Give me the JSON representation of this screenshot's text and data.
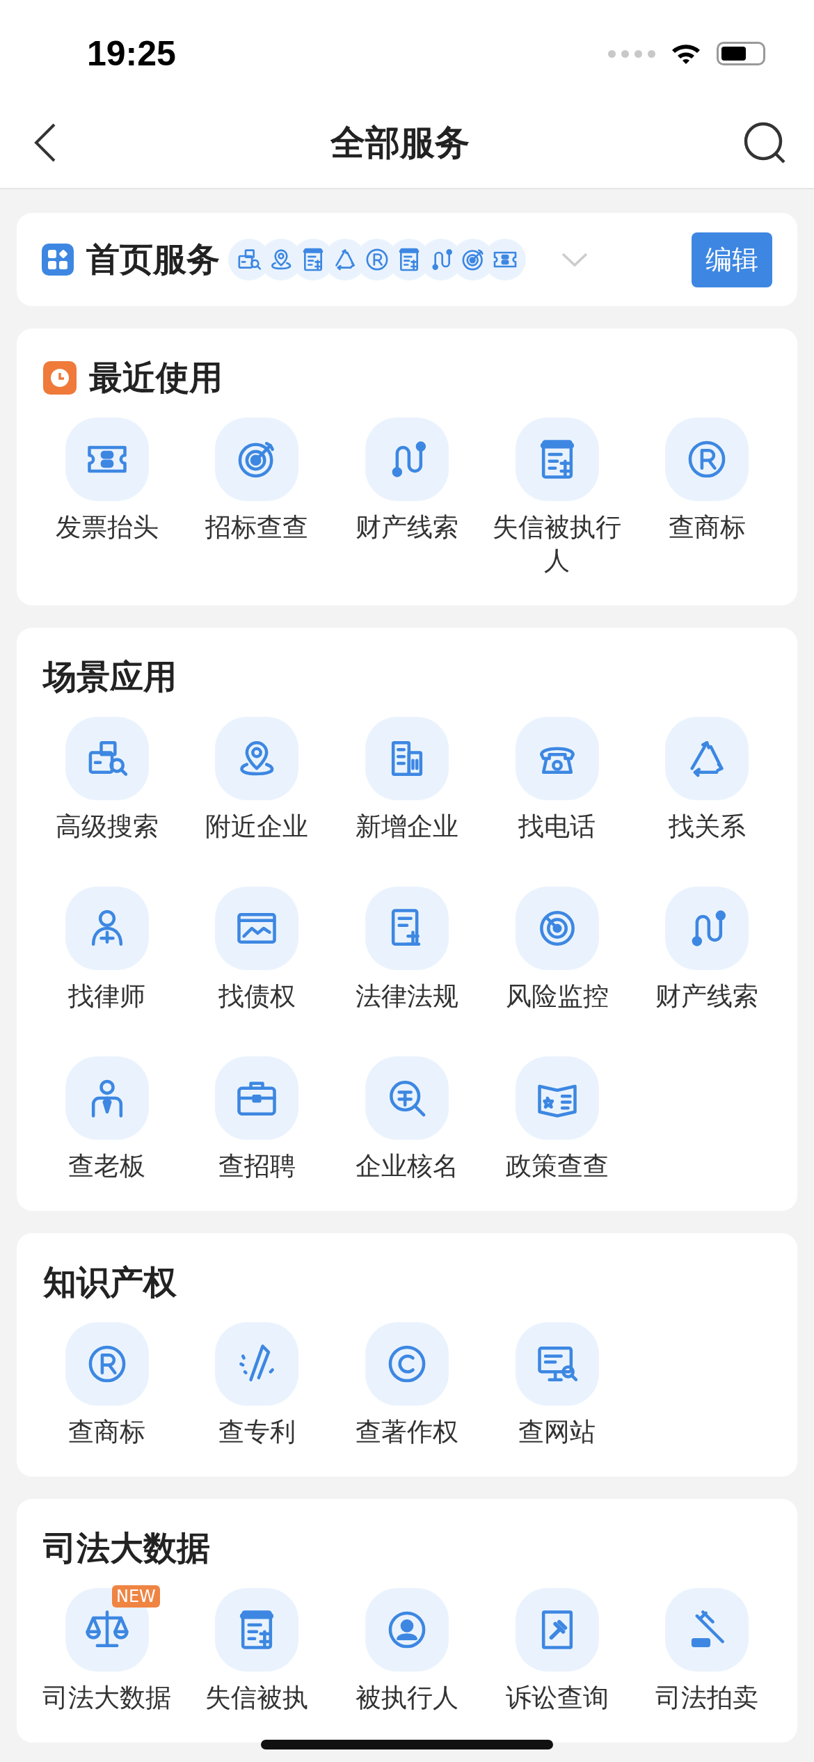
{
  "status_bar": {
    "time": "19:25"
  },
  "nav": {
    "title": "全部服务"
  },
  "home_services": {
    "title": "首页服务",
    "edit_button": "编辑"
  },
  "sections": [
    {
      "title": "最近使用",
      "kind": "recent",
      "items": [
        {
          "label": "发票抬头"
        },
        {
          "label": "招标查查"
        },
        {
          "label": "财产线索"
        },
        {
          "label": "失信被执行人"
        },
        {
          "label": "查商标"
        }
      ]
    },
    {
      "title": "场景应用",
      "kind": "plain",
      "items": [
        {
          "label": "高级搜索"
        },
        {
          "label": "附近企业"
        },
        {
          "label": "新增企业"
        },
        {
          "label": "找电话"
        },
        {
          "label": "找关系"
        },
        {
          "label": "找律师"
        },
        {
          "label": "找债权"
        },
        {
          "label": "法律法规"
        },
        {
          "label": "风险监控"
        },
        {
          "label": "财产线索"
        },
        {
          "label": "查老板"
        },
        {
          "label": "查招聘"
        },
        {
          "label": "企业核名"
        },
        {
          "label": "政策查查"
        }
      ]
    },
    {
      "title": "知识产权",
      "kind": "plain",
      "items": [
        {
          "label": "查商标"
        },
        {
          "label": "查专利"
        },
        {
          "label": "查著作权"
        },
        {
          "label": "查网站"
        }
      ]
    },
    {
      "title": "司法大数据",
      "kind": "plain",
      "items": [
        {
          "label": "司法大数据",
          "badge": "NEW"
        },
        {
          "label": "失信被执"
        },
        {
          "label": "被执行人"
        },
        {
          "label": "诉讼查询"
        },
        {
          "label": "司法拍卖"
        }
      ]
    }
  ]
}
